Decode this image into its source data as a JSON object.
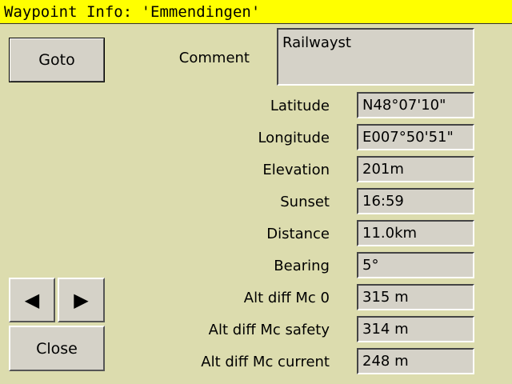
{
  "window": {
    "title": "Waypoint Info: 'Emmendingen'"
  },
  "buttons": {
    "goto": "Goto",
    "prev_icon": "◀",
    "next_icon": "▶",
    "close": "Close"
  },
  "icons": {
    "prev": "left-arrow-icon",
    "next": "right-arrow-icon"
  },
  "comment": {
    "label": "Comment",
    "value": "Railwayst"
  },
  "fields": [
    {
      "label": "Latitude",
      "value": "N48°07'10\""
    },
    {
      "label": "Longitude",
      "value": "E007°50'51\""
    },
    {
      "label": "Elevation",
      "value": "201m"
    },
    {
      "label": "Sunset",
      "value": "16:59"
    },
    {
      "label": "Distance",
      "value": "11.0km"
    },
    {
      "label": "Bearing",
      "value": "5°"
    },
    {
      "label": "Alt diff Mc 0",
      "value": "315 m"
    },
    {
      "label": "Alt diff Mc safety",
      "value": "314 m"
    },
    {
      "label": "Alt diff Mc current",
      "value": "248 m"
    }
  ],
  "colors": {
    "background": "#dcdcae",
    "title_bar": "#ffff00",
    "control": "#d5d2c8"
  }
}
